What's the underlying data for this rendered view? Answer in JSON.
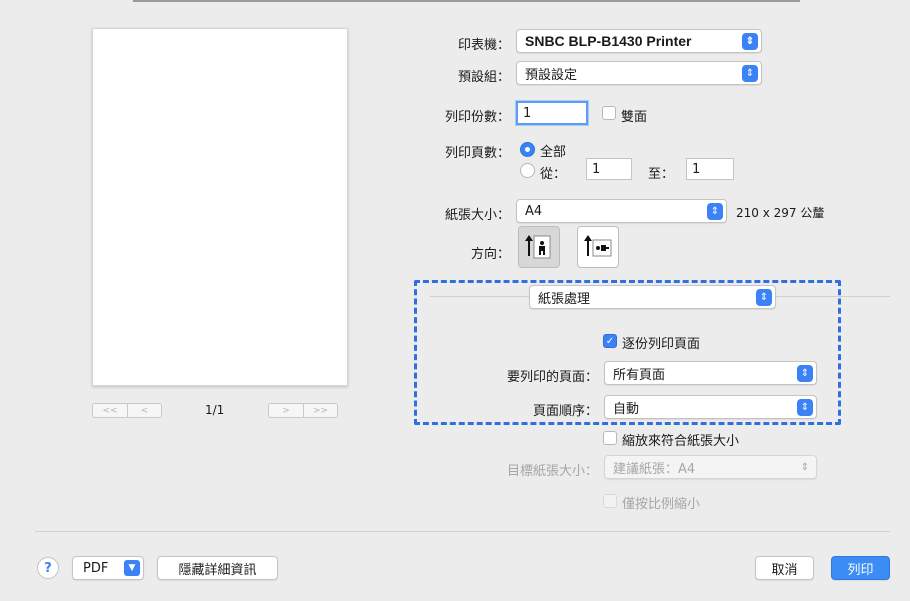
{
  "printer": {
    "label": "印表機：",
    "value": "SNBC BLP-B1430 Printer"
  },
  "presets": {
    "label": "預設組：",
    "value": "預設設定"
  },
  "copies": {
    "label": "列印份數：",
    "value": "1",
    "duplex_label": "雙面"
  },
  "pages": {
    "label": "列印頁數：",
    "all_label": "全部",
    "from_label": "從：",
    "from_value": "1",
    "to_label": "至：",
    "to_value": "1"
  },
  "paper_size": {
    "label": "紙張大小：",
    "value": "A4",
    "dimensions": "210 x 297 公釐"
  },
  "orientation": {
    "label": "方向："
  },
  "section_menu": {
    "value": "紙張處理"
  },
  "paper_handling": {
    "collate_label": "逐份列印頁面",
    "pages_to_print_label": "要列印的頁面：",
    "pages_to_print_value": "所有頁面",
    "page_order_label": "頁面順序：",
    "page_order_value": "自動",
    "scale_to_fit_label": "縮放來符合紙張大小",
    "dest_paper_label": "目標紙張大小：",
    "dest_paper_value": "建議紙張：A4",
    "scale_down_only_label": "僅按比例縮小"
  },
  "preview": {
    "page_indicator": "1/1",
    "first_glyph": "<<",
    "prev_glyph": "<",
    "next_glyph": ">",
    "last_glyph": ">>"
  },
  "footer": {
    "help_glyph": "?",
    "pdf_label": "PDF",
    "hide_details_label": "隱藏詳細資訊",
    "cancel_label": "取消",
    "print_label": "列印"
  },
  "colors": {
    "accent": "#3b82f6",
    "highlight_box": "#2f6fe0"
  }
}
